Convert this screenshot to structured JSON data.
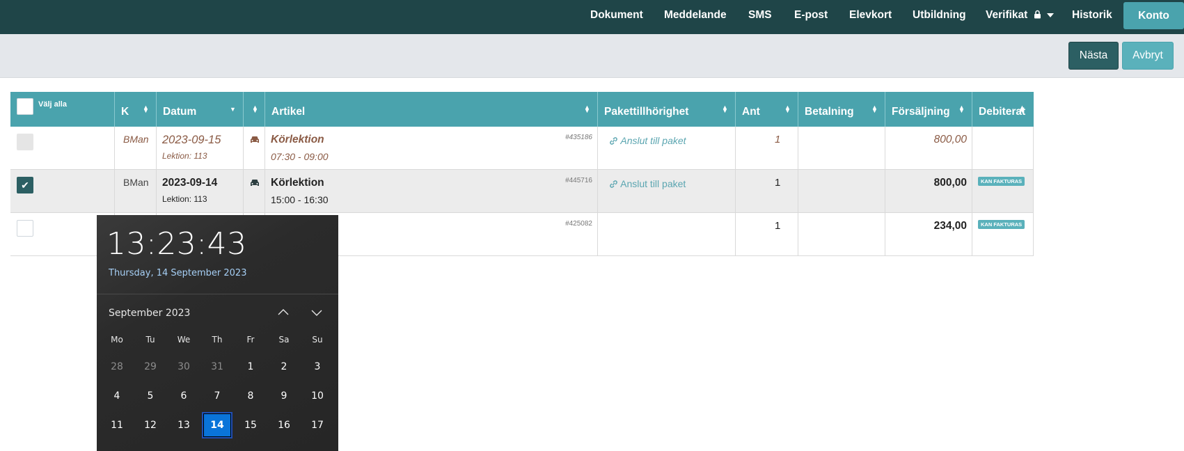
{
  "topnav": {
    "items": [
      "Dokument",
      "Meddelande",
      "SMS",
      "E-post",
      "Elevkort",
      "Utbildning",
      "Verifikat",
      "Historik"
    ],
    "account": "Konto"
  },
  "toolbar": {
    "next_label": "Nästa",
    "cancel_label": "Avbryt"
  },
  "table": {
    "select_all": "Välj alla",
    "headers": [
      "K",
      "Datum",
      "Artikel",
      "Pakettillhörighet",
      "Ant",
      "Betalning",
      "Försäljning",
      "Debiterat"
    ],
    "rows": [
      {
        "k": "BMan",
        "date": "2023-09-15",
        "lesson": "Lektion: 113",
        "article": "Körlektion",
        "time": "07:30 - 09:00",
        "id": "#435186",
        "package": "Anslut till paket",
        "qty": "1",
        "sale": "800,00",
        "badge": "",
        "state": "disabled"
      },
      {
        "k": "BMan",
        "date": "2023-09-14",
        "lesson": "Lektion: 113",
        "article": "Körlektion",
        "time": "15:00 - 16:30",
        "id": "#445716",
        "package": "Anslut till paket",
        "qty": "1",
        "sale": "800,00",
        "badge": "KAN FAKTURAS",
        "state": "checked"
      },
      {
        "k": "",
        "date": "",
        "lesson": "",
        "article": "",
        "time": "",
        "id": "#425082",
        "package": "",
        "qty": "1",
        "sale": "234,00",
        "badge": "KAN FAKTURAS",
        "state": "unchecked"
      }
    ]
  },
  "calendar": {
    "time": "13:23:43",
    "date": "Thursday, 14 September 2023",
    "month": "September 2023",
    "weekdays": [
      "Mo",
      "Tu",
      "We",
      "Th",
      "Fr",
      "Sa",
      "Su"
    ],
    "weeks": [
      [
        "28",
        "29",
        "30",
        "31",
        "1",
        "2",
        "3"
      ],
      [
        "4",
        "5",
        "6",
        "7",
        "8",
        "9",
        "10"
      ],
      [
        "11",
        "12",
        "13",
        "14",
        "15",
        "16",
        "17"
      ]
    ],
    "today": "14",
    "colors": {
      "accent": "#0a74d9",
      "date_text": "#a6cff5"
    }
  },
  "colors": {
    "nav_bg": "#1f4548",
    "table_header": "#4aa3ad",
    "button_dark": "#2c5f63"
  }
}
